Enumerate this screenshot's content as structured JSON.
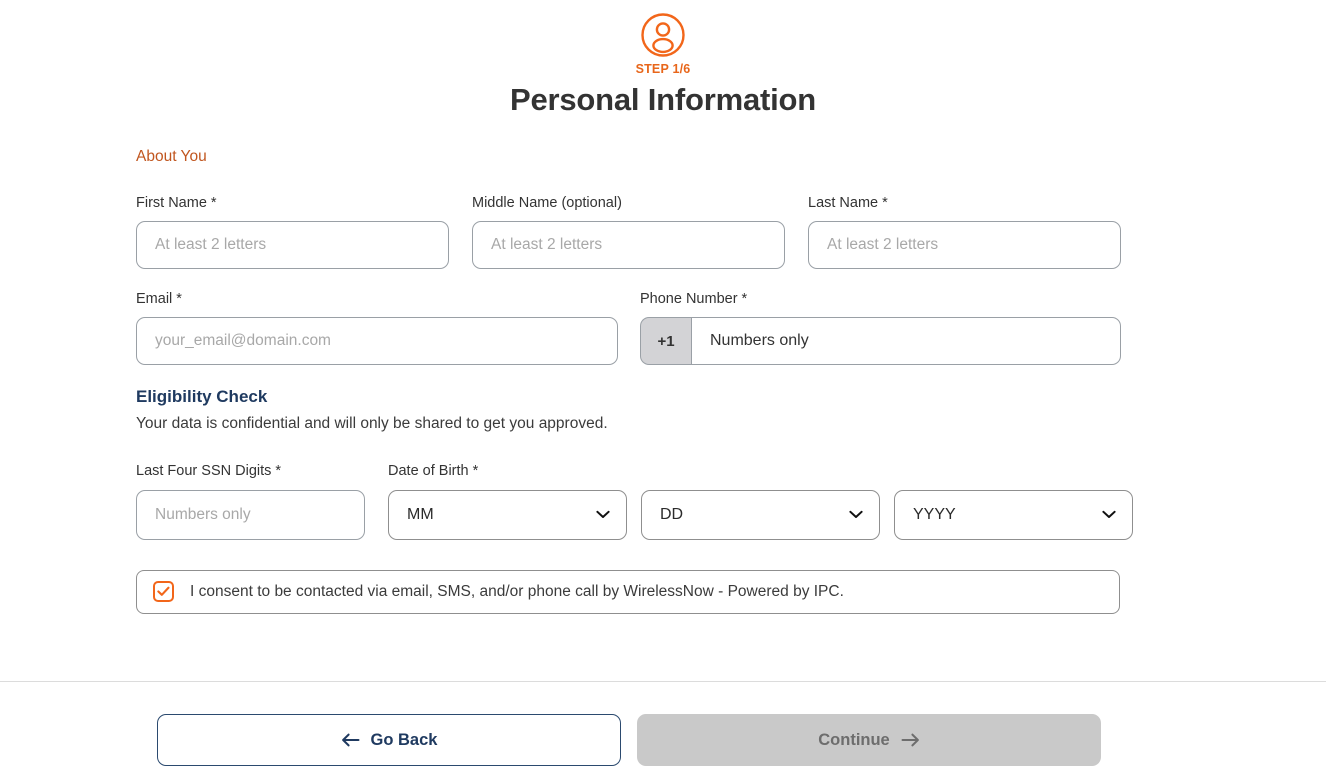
{
  "header": {
    "avatar_icon": "user-circle-icon",
    "step_label": "STEP 1/6",
    "title": "Personal Information",
    "accent_color": "#e8661a",
    "title_color": "#333333"
  },
  "about_section": {
    "label": "About You",
    "label_color": "#c1561f",
    "fields": {
      "first_name": {
        "label": "First Name *",
        "value": "",
        "placeholder": "At least 2 letters"
      },
      "middle_name": {
        "label": "Middle Name (optional)",
        "value": "",
        "placeholder": "At least 2 letters"
      },
      "last_name": {
        "label": "Last Name *",
        "value": "",
        "placeholder": "At least 2 letters"
      },
      "email": {
        "label": "Email *",
        "value": "",
        "placeholder": "your_email@domain.com"
      },
      "phone": {
        "label": "Phone Number *",
        "prefix": "+1",
        "value": "",
        "placeholder": "Numbers only"
      }
    }
  },
  "eligibility_section": {
    "heading": "Eligibility Check",
    "heading_color": "#1f3a60",
    "subtext": "Your data is confidential and will only be shared to get you approved.",
    "fields": {
      "ssn": {
        "label": "Last Four SSN Digits *",
        "value": "",
        "placeholder": "Numbers only"
      },
      "dob": {
        "label": "Date of Birth *",
        "month": {
          "selected": "MM",
          "icon": "chevron-down-icon"
        },
        "day": {
          "selected": "DD",
          "icon": "chevron-down-icon"
        },
        "year": {
          "selected": "YYYY",
          "icon": "chevron-down-icon"
        }
      }
    }
  },
  "consent": {
    "checked": true,
    "checkbox_color": "#f2661a",
    "text": "I consent to be contacted via email, SMS, and/or phone call by WirelessNow - Powered by IPC."
  },
  "footer": {
    "go_back": {
      "label": "Go Back",
      "icon": "arrow-left-icon",
      "enabled": true
    },
    "continue": {
      "label": "Continue",
      "icon": "arrow-right-icon",
      "enabled": false
    }
  }
}
